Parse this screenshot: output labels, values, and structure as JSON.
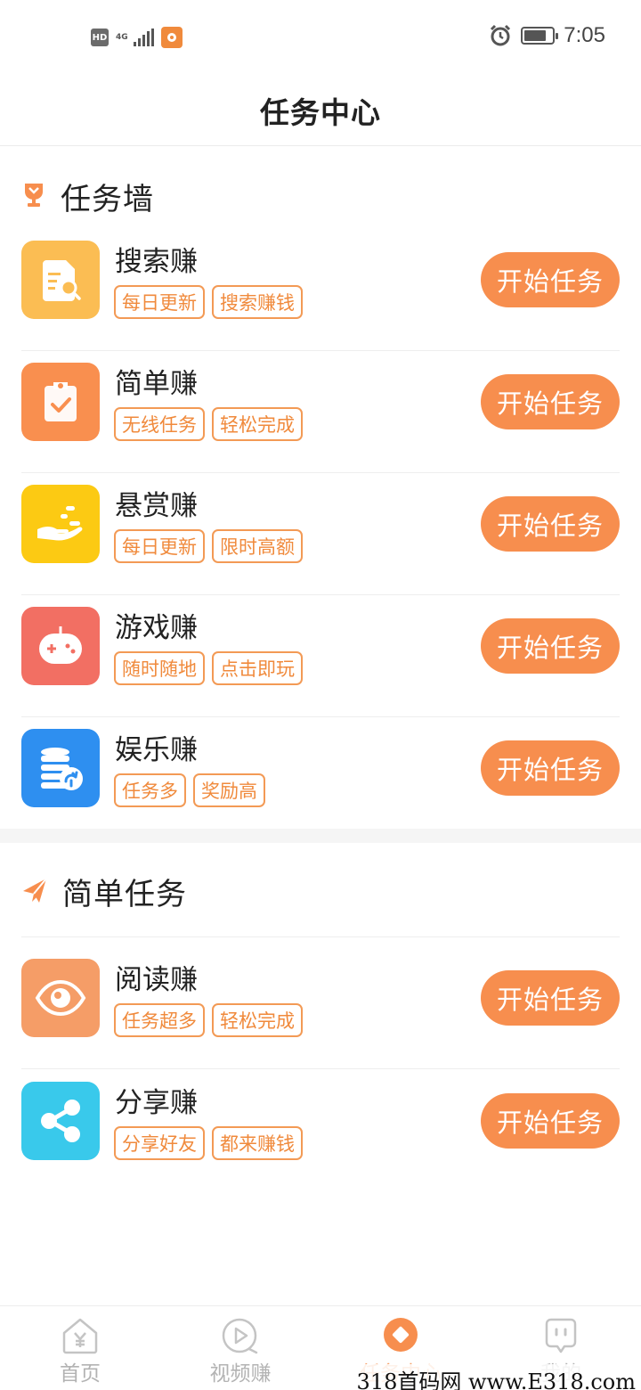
{
  "status_bar": {
    "hd": "HD",
    "network": "4G",
    "time": "7:05",
    "battery_level": 0.8
  },
  "title": "任务中心",
  "task_wall": {
    "title": "任务墙",
    "items": [
      {
        "name": "搜索赚",
        "tags": [
          "每日更新",
          "搜索赚钱"
        ],
        "button": "开始任务",
        "icon": "search-doc-icon",
        "color": "#fbbd53"
      },
      {
        "name": "简单赚",
        "tags": [
          "无线任务",
          "轻松完成"
        ],
        "button": "开始任务",
        "icon": "clipboard-check-icon",
        "color": "#f98f4f"
      },
      {
        "name": "悬赏赚",
        "tags": [
          "每日更新",
          "限时高额"
        ],
        "button": "开始任务",
        "icon": "hand-reward-icon",
        "color": "#fcca13"
      },
      {
        "name": "游戏赚",
        "tags": [
          "随时随地",
          "点击即玩"
        ],
        "button": "开始任务",
        "icon": "gamepad-icon",
        "color": "#f26f63"
      },
      {
        "name": "娱乐赚",
        "tags": [
          "任务多",
          "奖励高"
        ],
        "button": "开始任务",
        "icon": "database-refresh-icon",
        "color": "#2e8ff0"
      }
    ]
  },
  "simple_tasks": {
    "title": "简单任务",
    "items": [
      {
        "name": "阅读赚",
        "tags": [
          "任务超多",
          "轻松完成"
        ],
        "button": "开始任务",
        "icon": "eye-icon",
        "color": "#f59d67"
      },
      {
        "name": "分享赚",
        "tags": [
          "分享好友",
          "都来赚钱"
        ],
        "button": "开始任务",
        "icon": "share-icon",
        "color": "#39c9eb"
      }
    ]
  },
  "bottom_nav": [
    {
      "label": "首页",
      "icon": "home-yen-icon",
      "active": false
    },
    {
      "label": "视频赚",
      "icon": "play-icon",
      "active": false
    },
    {
      "label": "任务中心",
      "icon": "task-center-icon",
      "active": true
    },
    {
      "label": "我的",
      "icon": "profile-icon",
      "active": false
    }
  ],
  "watermark": "318首码网  www.E318.com",
  "colors": {
    "accent": "#f78e4e",
    "tag": "#f08a3c"
  }
}
